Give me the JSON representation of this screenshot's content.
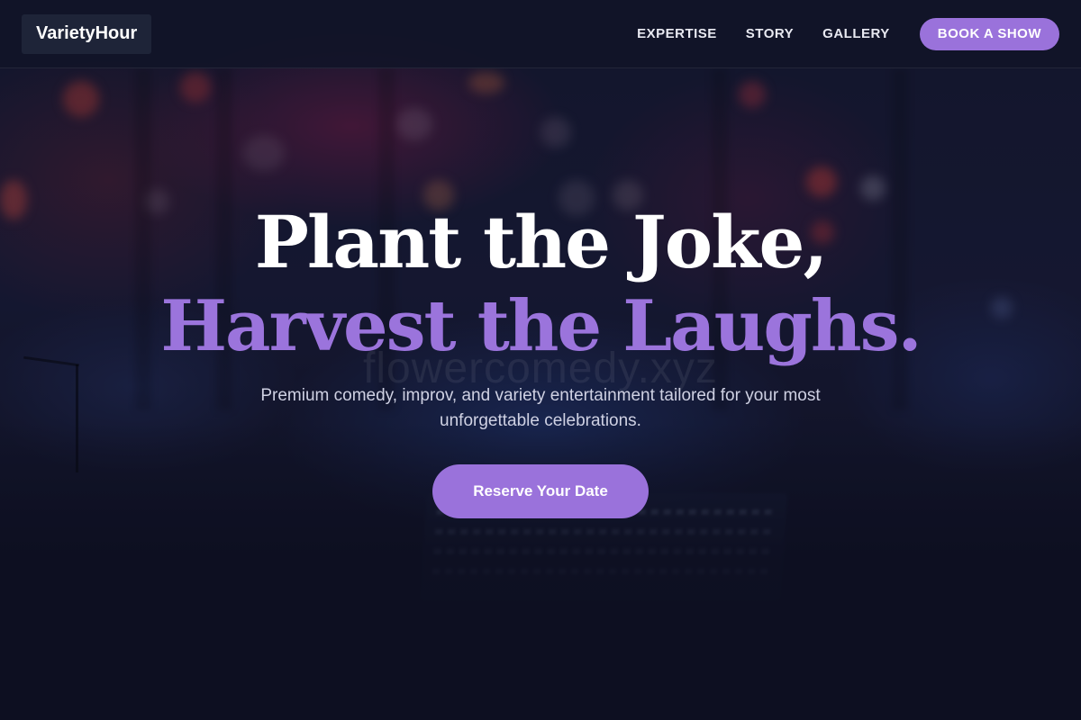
{
  "header": {
    "brand": "VarietyHour",
    "nav": [
      {
        "label": "EXPERTISE"
      },
      {
        "label": "STORY"
      },
      {
        "label": "GALLERY"
      }
    ],
    "cta_label": "BOOK A SHOW"
  },
  "hero": {
    "headline_line1": "Plant the Joke,",
    "headline_line2": "Harvest the Laughs.",
    "watermark": "flowercomedy.xyz",
    "subtitle": "Premium comedy, improv, and variety entertainment tailored for your most unforgettable celebrations.",
    "cta_label": "Reserve Your Date"
  },
  "colors": {
    "accent": "#9a72db",
    "headline_accent": "#9b74dc",
    "background": "#0f1124",
    "header_bg": "#111428"
  }
}
